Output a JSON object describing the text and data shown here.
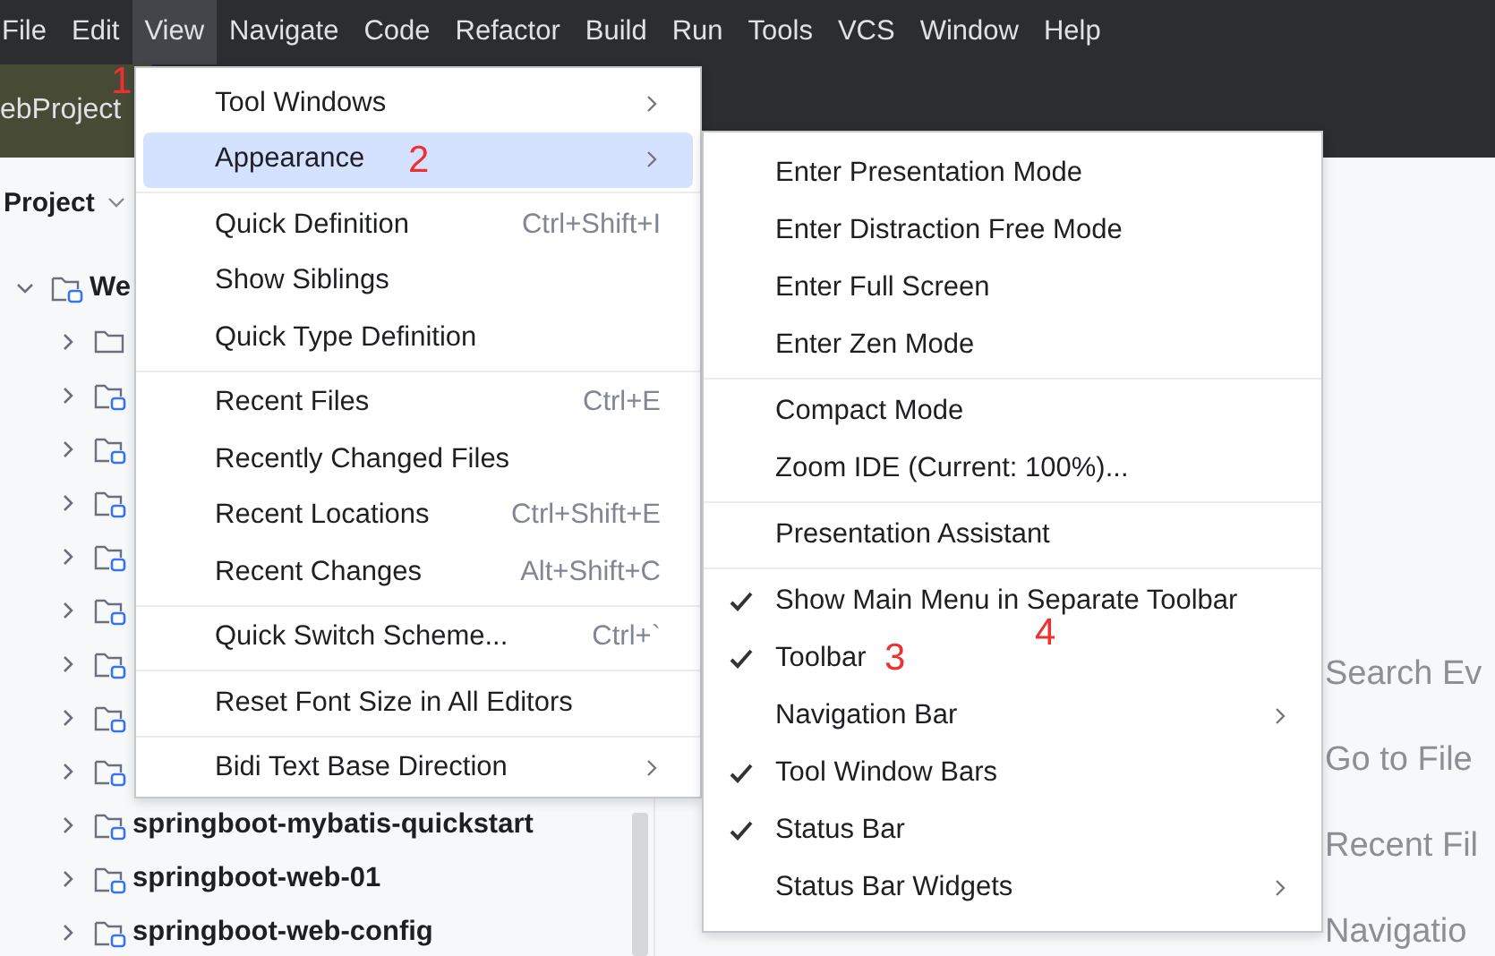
{
  "menubar": [
    {
      "label": "File",
      "selected": false
    },
    {
      "label": "Edit",
      "selected": false
    },
    {
      "label": "View",
      "selected": true
    },
    {
      "label": "Navigate",
      "selected": false
    },
    {
      "label": "Code",
      "selected": false
    },
    {
      "label": "Refactor",
      "selected": false
    },
    {
      "label": "Build",
      "selected": false
    },
    {
      "label": "Run",
      "selected": false
    },
    {
      "label": "Tools",
      "selected": false
    },
    {
      "label": "VCS",
      "selected": false
    },
    {
      "label": "Window",
      "selected": false
    },
    {
      "label": "Help",
      "selected": false
    }
  ],
  "toolbar": {
    "project_widget": "ebProject"
  },
  "project_panel": {
    "title": "Project",
    "tree": {
      "label": "We",
      "expanded": true,
      "kind": "module",
      "children": [
        {
          "kind": "folder",
          "expanded": false
        },
        {
          "kind": "module",
          "expanded": false
        },
        {
          "kind": "module",
          "expanded": false
        },
        {
          "kind": "module",
          "expanded": false
        },
        {
          "kind": "module",
          "expanded": false
        },
        {
          "kind": "module",
          "expanded": false
        },
        {
          "kind": "module",
          "expanded": false
        },
        {
          "kind": "module",
          "expanded": false
        },
        {
          "kind": "module",
          "expanded": false
        },
        {
          "kind": "module",
          "expanded": false,
          "label": "springboot-mybatis-quickstart"
        },
        {
          "kind": "module",
          "expanded": false,
          "label": "springboot-web-01"
        },
        {
          "kind": "module",
          "expanded": false,
          "label": "springboot-web-config"
        }
      ]
    }
  },
  "editor_hints": [
    "Search Ev",
    "Go to File",
    "Recent Fil",
    "Navigatio"
  ],
  "view_menu": {
    "groups": [
      [
        {
          "label": "Tool Windows",
          "submenu": true,
          "selected": false
        },
        {
          "label": "Appearance",
          "submenu": true,
          "selected": true
        }
      ],
      [
        {
          "label": "Quick Definition",
          "shortcut": "Ctrl+Shift+I",
          "submenu": false,
          "selected": false
        },
        {
          "label": "Show Siblings",
          "submenu": false,
          "selected": false
        },
        {
          "label": "Quick Type Definition",
          "submenu": false,
          "selected": false
        }
      ],
      [
        {
          "label": "Recent Files",
          "shortcut": "Ctrl+E",
          "submenu": false,
          "selected": false
        },
        {
          "label": "Recently Changed Files",
          "submenu": false,
          "selected": false
        },
        {
          "label": "Recent Locations",
          "shortcut": "Ctrl+Shift+E",
          "submenu": false,
          "selected": false
        },
        {
          "label": "Recent Changes",
          "shortcut": "Alt+Shift+C",
          "submenu": false,
          "selected": false
        }
      ],
      [
        {
          "label": "Quick Switch Scheme...",
          "shortcut": "Ctrl+`",
          "submenu": false,
          "selected": false
        }
      ],
      [
        {
          "label": "Reset Font Size in All Editors",
          "submenu": false,
          "selected": false
        }
      ],
      [
        {
          "label": "Bidi Text Base Direction",
          "submenu": true,
          "selected": false
        }
      ]
    ]
  },
  "appearance_menu": {
    "groups": [
      [
        {
          "label": "Enter Presentation Mode",
          "checked": false,
          "submenu": false
        },
        {
          "label": "Enter Distraction Free Mode",
          "checked": false,
          "submenu": false
        },
        {
          "label": "Enter Full Screen",
          "checked": false,
          "submenu": false
        },
        {
          "label": "Enter Zen Mode",
          "checked": false,
          "submenu": false
        }
      ],
      [
        {
          "label": "Compact Mode",
          "checked": false,
          "submenu": false
        },
        {
          "label": "Zoom IDE (Current: 100%)...",
          "checked": false,
          "submenu": false
        }
      ],
      [
        {
          "label": "Presentation Assistant",
          "checked": false,
          "submenu": false
        }
      ],
      [
        {
          "label": "Show Main Menu in Separate Toolbar",
          "checked": true,
          "submenu": false
        },
        {
          "label": "Toolbar",
          "checked": true,
          "submenu": false
        },
        {
          "label": "Navigation Bar",
          "checked": false,
          "submenu": true
        },
        {
          "label": "Tool Window Bars",
          "checked": true,
          "submenu": false
        },
        {
          "label": "Status Bar",
          "checked": true,
          "submenu": false
        },
        {
          "label": "Status Bar Widgets",
          "checked": false,
          "submenu": true
        }
      ]
    ]
  },
  "annotations": [
    {
      "label": "1"
    },
    {
      "label": "2"
    },
    {
      "label": "3"
    },
    {
      "label": "4"
    }
  ]
}
